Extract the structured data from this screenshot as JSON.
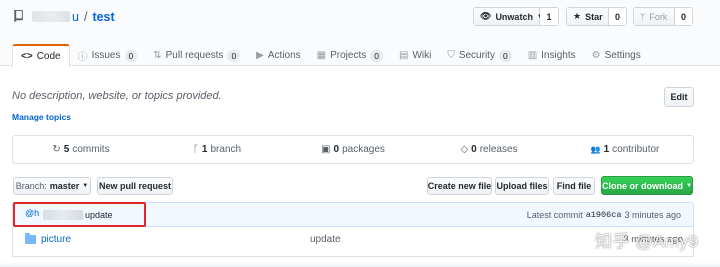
{
  "repo": {
    "owner_suffix": "u",
    "separator": "/",
    "name": "test"
  },
  "actions": {
    "watch": {
      "label": "Unwatch",
      "count": "1"
    },
    "star": {
      "label": "Star",
      "count": "0"
    },
    "fork": {
      "label": "Fork",
      "count": "0"
    }
  },
  "tabs": [
    {
      "icon": "code-icon",
      "glyph": "<>",
      "label": "Code",
      "counter": null
    },
    {
      "icon": "issue-icon",
      "glyph": "ⓘ",
      "label": "Issues",
      "counter": "0"
    },
    {
      "icon": "pull-request-icon",
      "glyph": "⇅",
      "label": "Pull requests",
      "counter": "0"
    },
    {
      "icon": "play-icon",
      "glyph": "▶",
      "label": "Actions",
      "counter": null
    },
    {
      "icon": "project-icon",
      "glyph": "▦",
      "label": "Projects",
      "counter": "0"
    },
    {
      "icon": "book-icon",
      "glyph": "▤",
      "label": "Wiki",
      "counter": null
    },
    {
      "icon": "shield-icon",
      "glyph": "⛉",
      "label": "Security",
      "counter": "0"
    },
    {
      "icon": "graph-icon",
      "glyph": "▥",
      "label": "Insights",
      "counter": null
    },
    {
      "icon": "gear-icon",
      "glyph": "⚙",
      "label": "Settings",
      "counter": null
    }
  ],
  "description": "No description, website, or topics provided.",
  "manage_topics": "Manage topics",
  "edit_label": "Edit",
  "summary": [
    {
      "icon": "history-icon",
      "glyph": "↻",
      "value": "5",
      "label": "commits"
    },
    {
      "icon": "branch-icon",
      "glyph": "ᚴ",
      "value": "1",
      "label": "branch"
    },
    {
      "icon": "package-icon",
      "glyph": "▣",
      "value": "0",
      "label": "packages"
    },
    {
      "icon": "tag-icon",
      "glyph": "◇",
      "value": "0",
      "label": "releases"
    },
    {
      "icon": "people-icon",
      "glyph": "👥",
      "value": "1",
      "label": "contributor"
    }
  ],
  "file_nav": {
    "branch_prefix": "Branch:",
    "branch_name": "master",
    "new_pull_request": "New pull request",
    "create_new_file": "Create new file",
    "upload_files": "Upload files",
    "find_file": "Find file",
    "clone_or_download": "Clone or download"
  },
  "commit": {
    "avatar": "@h",
    "message": "update",
    "latest_label": "Latest commit",
    "sha": "a1906ca",
    "age": "3 minutes ago"
  },
  "files": [
    {
      "name": "picture",
      "message": "update",
      "age": "3 minutes ago"
    }
  ],
  "watermark": "知乎 @Amy9",
  "colors": {
    "link": "#0366d6",
    "tab_accent": "#e36209",
    "clone_green": "#28a745",
    "highlight_red": "#e0252b",
    "commit_bg": "#f1f8ff"
  }
}
